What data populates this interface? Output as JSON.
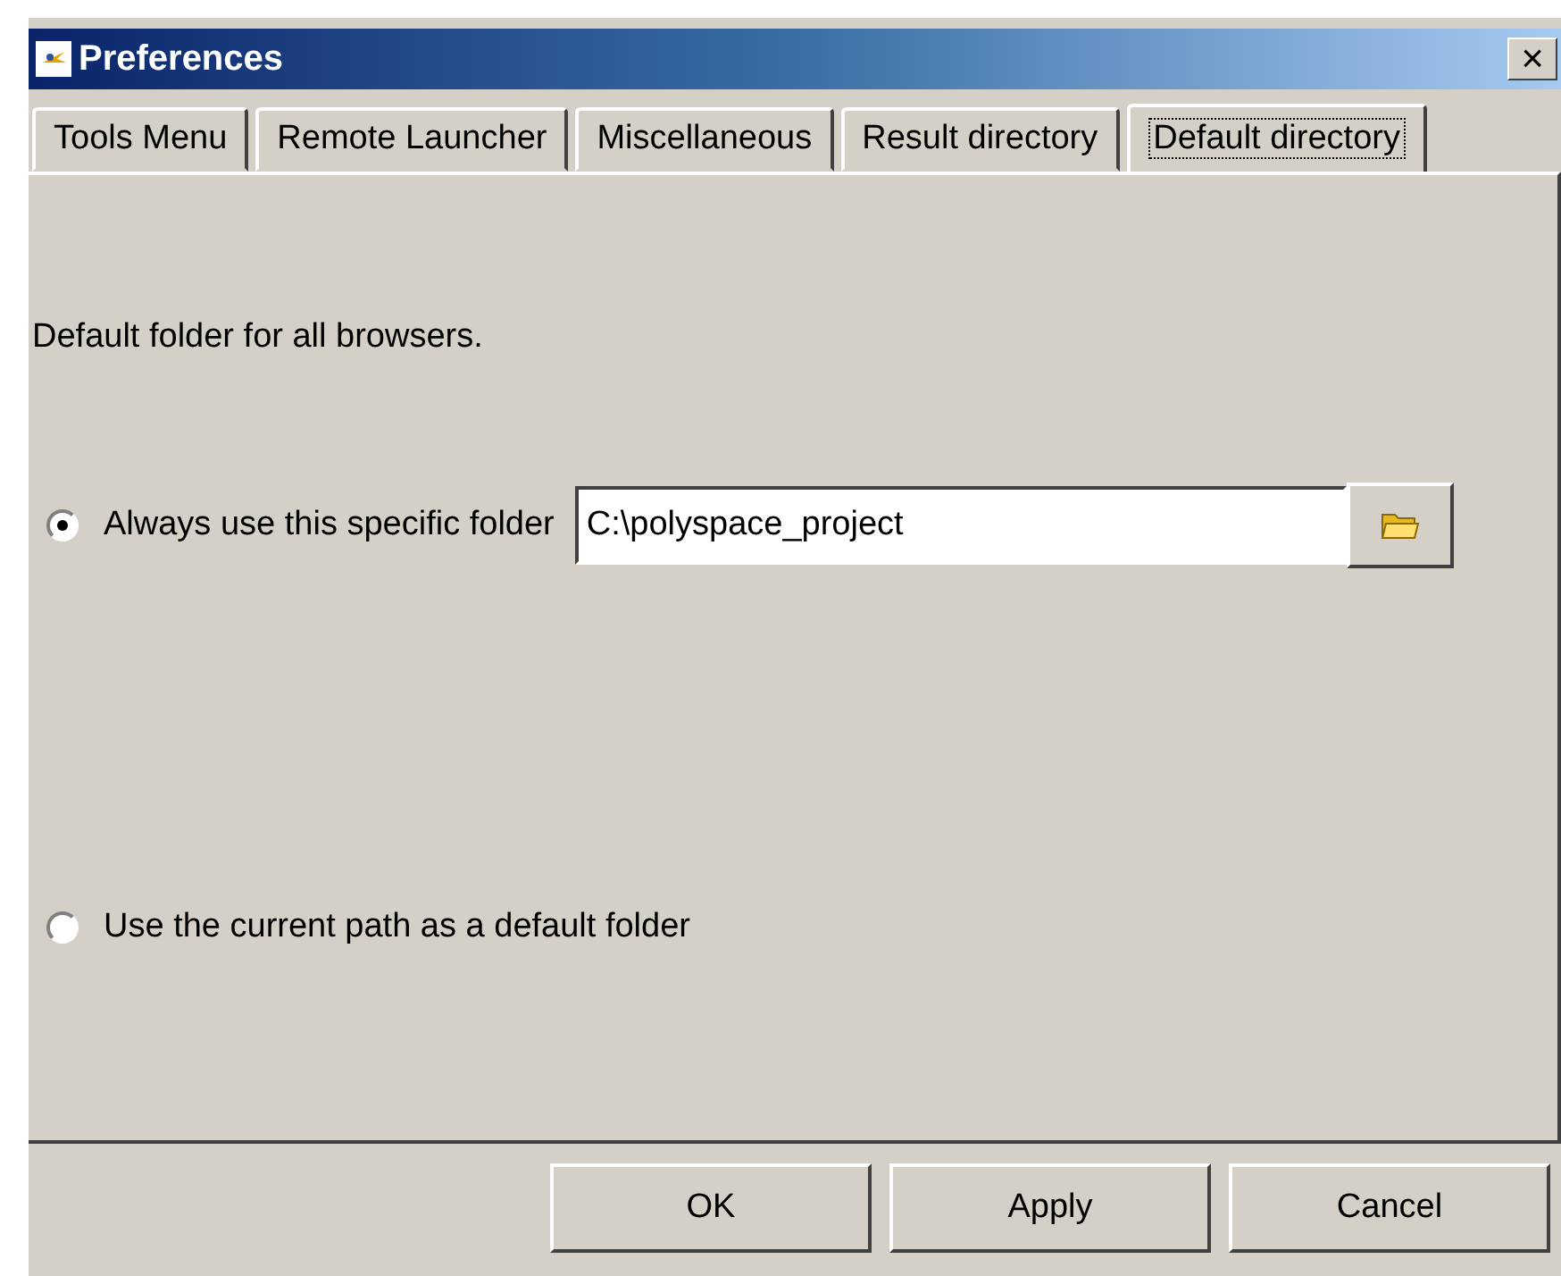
{
  "window": {
    "title": "Preferences",
    "close": "×"
  },
  "tabs": [
    {
      "label": "Tools Menu",
      "selected": false
    },
    {
      "label": "Remote Launcher",
      "selected": false
    },
    {
      "label": "Miscellaneous",
      "selected": false
    },
    {
      "label": "Result directory",
      "selected": false
    },
    {
      "label": "Default directory",
      "selected": true
    }
  ],
  "description": "Default folder for all browsers.",
  "options": [
    {
      "label": "Always use this specific folder",
      "selected": true,
      "path": "C:\\polyspace_project"
    },
    {
      "label": "Use the current path as a default folder",
      "selected": false
    }
  ],
  "buttons": [
    "OK",
    "Apply",
    "Cancel"
  ]
}
